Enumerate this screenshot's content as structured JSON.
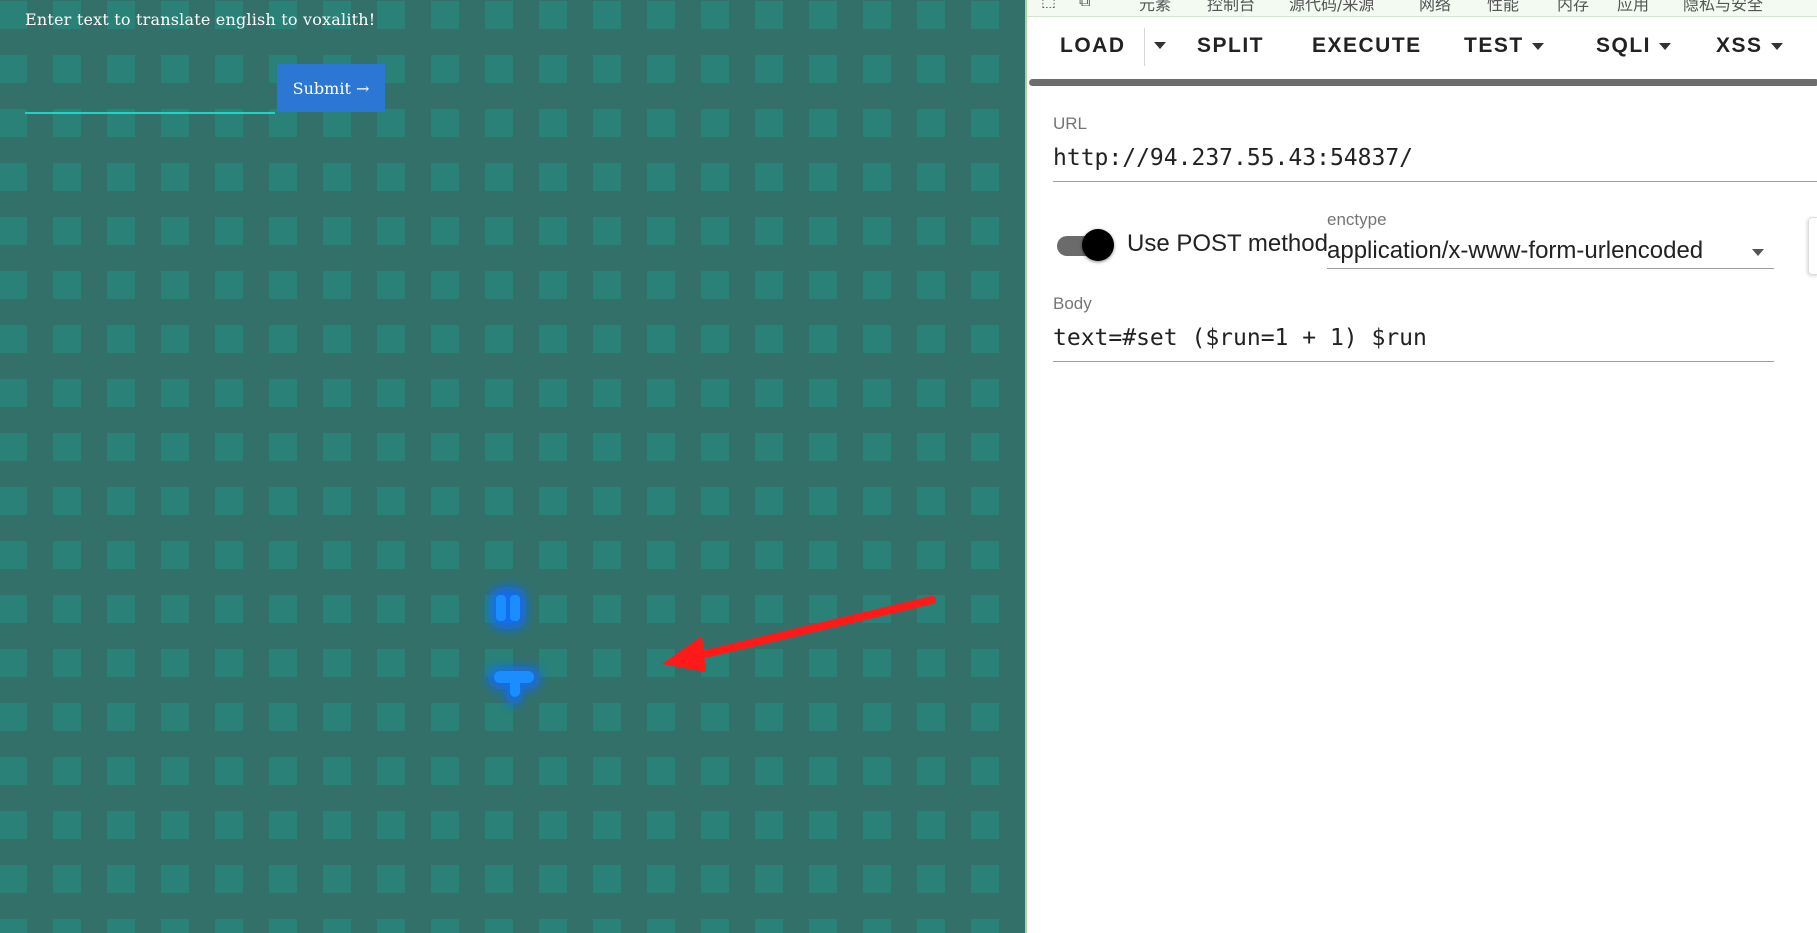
{
  "left_page": {
    "prompt": "Enter text to translate english to voxalith!",
    "submit_label": "Submit →",
    "input_value": ""
  },
  "hackbar": {
    "top_tabs": [
      "元素",
      "控制台",
      "源代码/来源",
      "网络",
      "性能",
      "内存",
      "应用",
      "隐私与安全"
    ],
    "toolbar": {
      "load": "LOAD",
      "split": "SPLIT",
      "execute": "EXECUTE",
      "test": "TEST",
      "sqli": "SQLI",
      "xss": "XSS"
    },
    "url_label": "URL",
    "url_value": "http://94.237.55.43:54837/",
    "post_toggle_label": "Use POST method",
    "post_enabled": true,
    "enctype_label": "enctype",
    "enctype_value": "application/x-www-form-urlencoded",
    "body_label": "Body",
    "body_value": "text=#set ($run=1 + 1) $run"
  },
  "colors": {
    "page_bg": "#33706a",
    "tile": "#2a8178",
    "submit_bg": "#2b77d3",
    "annotation_arrow": "#ff1a1a",
    "glow": "#0a6cff"
  }
}
